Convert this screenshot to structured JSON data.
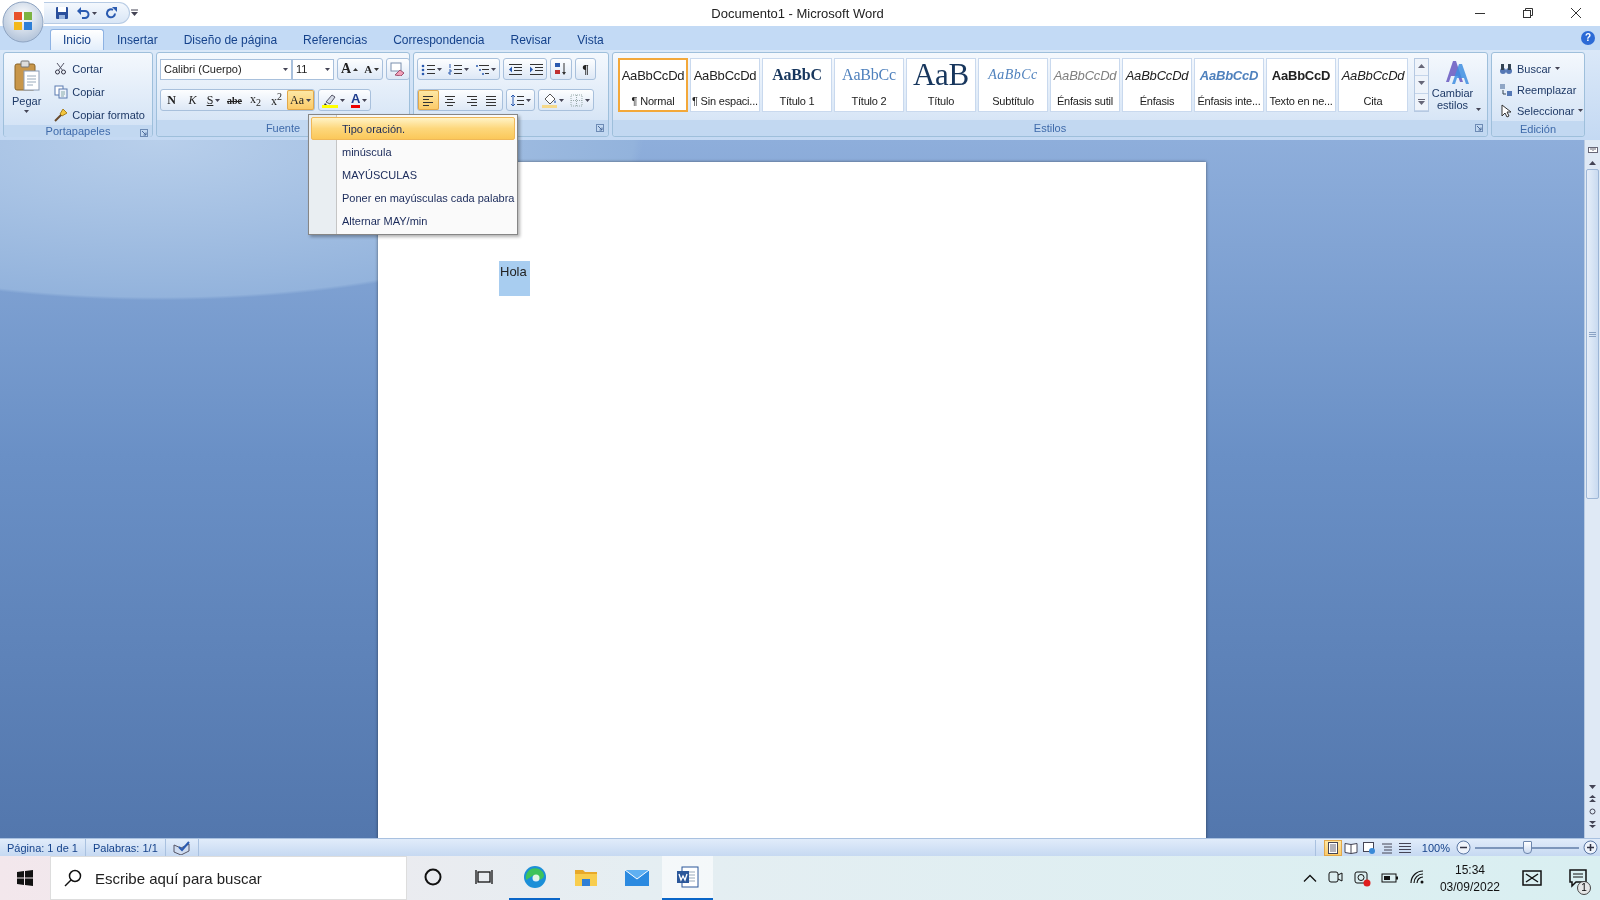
{
  "window": {
    "title": "Documento1 - Microsoft Word",
    "help": "?"
  },
  "tabs": [
    {
      "label": "Inicio",
      "selected": true
    },
    {
      "label": "Insertar",
      "selected": false
    },
    {
      "label": "Diseño de página",
      "selected": false
    },
    {
      "label": "Referencias",
      "selected": false
    },
    {
      "label": "Correspondencia",
      "selected": false
    },
    {
      "label": "Revisar",
      "selected": false
    },
    {
      "label": "Vista",
      "selected": false
    }
  ],
  "clipboard": {
    "title": "Portapapeles",
    "paste": "Pegar",
    "actions": [
      {
        "kind": "cut",
        "label": "Cortar"
      },
      {
        "kind": "copy",
        "label": "Copiar"
      },
      {
        "kind": "format_painter",
        "label": "Copiar formato"
      }
    ]
  },
  "font": {
    "title": "Fuente",
    "font_name": "Calibri (Cuerpo)",
    "font_size": "11",
    "size_buttons": [
      {
        "kind": "grow",
        "label": "A"
      },
      {
        "kind": "shrink",
        "label": "A"
      }
    ],
    "format_buttons": [
      {
        "kind": "bold",
        "label": "N",
        "dropdown": false,
        "selected": false
      },
      {
        "kind": "italic",
        "label": "K",
        "dropdown": false,
        "selected": false
      },
      {
        "kind": "underline",
        "label": "S",
        "dropdown": true,
        "selected": false
      },
      {
        "kind": "strike",
        "label": "abe",
        "dropdown": false,
        "selected": false
      },
      {
        "kind": "plain",
        "label": "x$_{2}$",
        "dropdown": false,
        "selected": false
      },
      {
        "kind": "plain",
        "label": "x$^{2}$",
        "dropdown": false,
        "selected": false
      },
      {
        "kind": "plain",
        "label": "Aa",
        "dropdown": true,
        "selected": true
      }
    ],
    "font_color": "A"
  },
  "paragraph": {
    "pilcrow": "¶",
    "alignment": [
      {
        "kind": "left",
        "selected": true
      },
      {
        "kind": "center",
        "selected": false
      },
      {
        "kind": "right",
        "selected": false
      },
      {
        "kind": "justify",
        "selected": false
      }
    ]
  },
  "styles": {
    "title": "Estilos",
    "change_styles": "Cambiar estilos",
    "items": [
      {
        "kind": "normal",
        "sample": "AaBbCcDd",
        "label": "¶ Normal",
        "selected": true
      },
      {
        "kind": "normal",
        "sample": "AaBbCcDd",
        "label": "¶ Sin espaci...",
        "selected": false
      },
      {
        "kind": "heading1",
        "sample": "AaBbC",
        "label": "Título 1",
        "selected": false
      },
      {
        "kind": "heading2",
        "sample": "AaBbCc",
        "label": "Título 2",
        "selected": false
      },
      {
        "kind": "title",
        "sample": "AaB",
        "label": "Título",
        "selected": false
      },
      {
        "kind": "subtitle",
        "sample": "AaBbCc",
        "label": "Subtítulo",
        "selected": false
      },
      {
        "kind": "subtle",
        "sample": "AaBbCcDd",
        "label": "Énfasis sutil",
        "selected": false
      },
      {
        "kind": "emphasis",
        "sample": "AaBbCcDd",
        "label": "Énfasis",
        "selected": false
      },
      {
        "kind": "intense",
        "sample": "AaBbCcD",
        "label": "Énfasis inte...",
        "selected": false
      },
      {
        "kind": "strong",
        "sample": "AaBbCcD",
        "label": "Texto en ne...",
        "selected": false
      },
      {
        "kind": "emphasis",
        "sample": "AaBbCcDd",
        "label": "Cita",
        "selected": false
      }
    ]
  },
  "editing": {
    "title": "Edición",
    "actions": [
      {
        "kind": "find",
        "label": "Buscar",
        "dropdown": true
      },
      {
        "kind": "replace",
        "label": "Reemplazar",
        "dropdown": false
      },
      {
        "kind": "select",
        "label": "Seleccionar",
        "dropdown": true
      }
    ]
  },
  "case_menu": {
    "items": [
      {
        "label": "Tipo oración.",
        "selected": true
      },
      {
        "label": "minúscula",
        "selected": false
      },
      {
        "label": "MAYÚSCULAS",
        "selected": false
      },
      {
        "label": "Poner en mayúsculas cada palabra",
        "selected": false
      },
      {
        "label": "Alternar MAY/min",
        "selected": false
      }
    ]
  },
  "document": {
    "text": "Hola",
    "selected": true
  },
  "status_bar": {
    "page": "Página: 1 de 1",
    "words": "Palabras: 1/1",
    "zoom": "100%",
    "zoom_slider": {
      "level": 0.5
    },
    "views": [
      {
        "kind": "print",
        "selected": true
      },
      {
        "kind": "reading",
        "selected": false
      },
      {
        "kind": "web",
        "selected": false
      },
      {
        "kind": "outline",
        "selected": false
      },
      {
        "kind": "draft",
        "selected": false
      }
    ]
  },
  "taskbar": {
    "search_placeholder": "Escribe aquí para buscar",
    "time": "15:34",
    "date": "03/09/2022",
    "notifications": "1",
    "apps": [
      {
        "kind": "edge",
        "running": true,
        "selected": false
      },
      {
        "kind": "explorer",
        "running": false,
        "selected": false
      },
      {
        "kind": "mail",
        "running": false,
        "selected": false
      },
      {
        "kind": "word",
        "running": true,
        "selected": true
      }
    ]
  }
}
